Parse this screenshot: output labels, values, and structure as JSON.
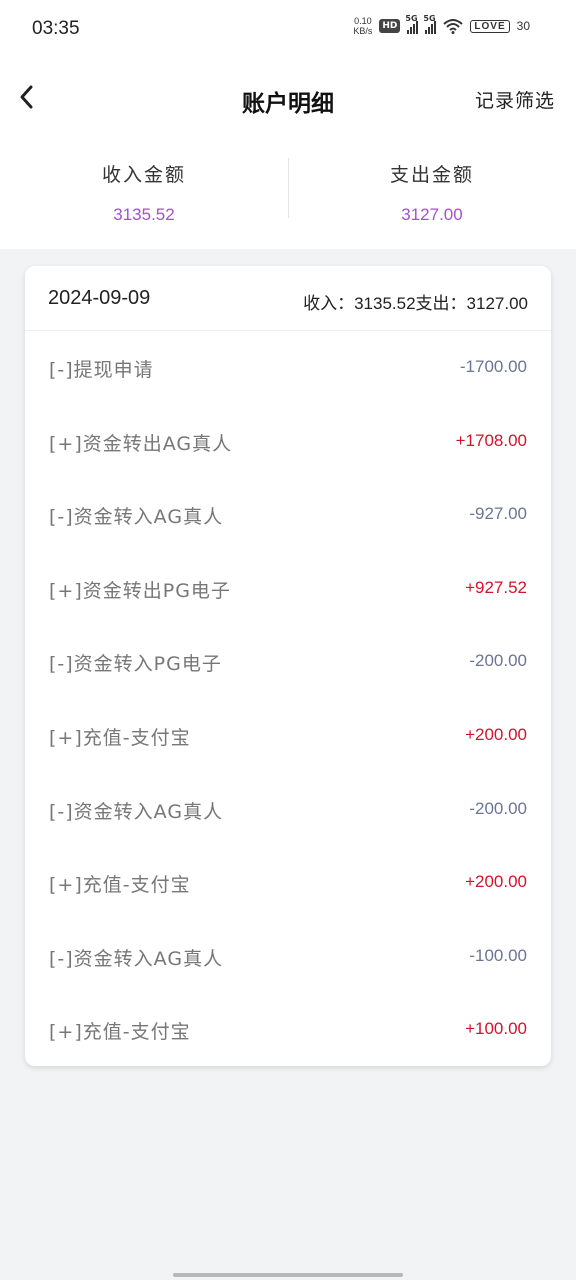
{
  "status_bar": {
    "time": "03:35",
    "net_speed_value": "0.10",
    "net_speed_unit": "KB/s",
    "hd_badge": "HD",
    "signal_label": "5G",
    "battery_text": "LOVE",
    "battery_level": "30"
  },
  "nav": {
    "title": "账户明细",
    "right_action": "记录筛选"
  },
  "summary": {
    "income_label": "收入金额",
    "income_value": "3135.52",
    "expense_label": "支出金额",
    "expense_value": "3127.00"
  },
  "day": {
    "date": "2024-09-09",
    "income_label": "收入：",
    "income_value": "3135.52",
    "expense_label": "支出：",
    "expense_value": "3127.00",
    "records": [
      {
        "label": "[-]提现申请",
        "amount": "-1700.00",
        "type": "neg"
      },
      {
        "label": "[+]资金转出AG真人",
        "amount": "+1708.00",
        "type": "pos"
      },
      {
        "label": "[-]资金转入AG真人",
        "amount": "-927.00",
        "type": "neg"
      },
      {
        "label": "[+]资金转出PG电子",
        "amount": "+927.52",
        "type": "pos"
      },
      {
        "label": "[-]资金转入PG电子",
        "amount": "-200.00",
        "type": "neg"
      },
      {
        "label": "[+]充值-支付宝",
        "amount": "+200.00",
        "type": "pos"
      },
      {
        "label": "[-]资金转入AG真人",
        "amount": "-200.00",
        "type": "neg"
      },
      {
        "label": "[+]充值-支付宝",
        "amount": "+200.00",
        "type": "pos"
      },
      {
        "label": "[-]资金转入AG真人",
        "amount": "-100.00",
        "type": "neg"
      },
      {
        "label": "[+]充值-支付宝",
        "amount": "+100.00",
        "type": "pos"
      }
    ]
  },
  "colors": {
    "summary_value": "#a64fd0",
    "negative_amount": "#6b7595",
    "positive_amount": "#d4132d"
  }
}
